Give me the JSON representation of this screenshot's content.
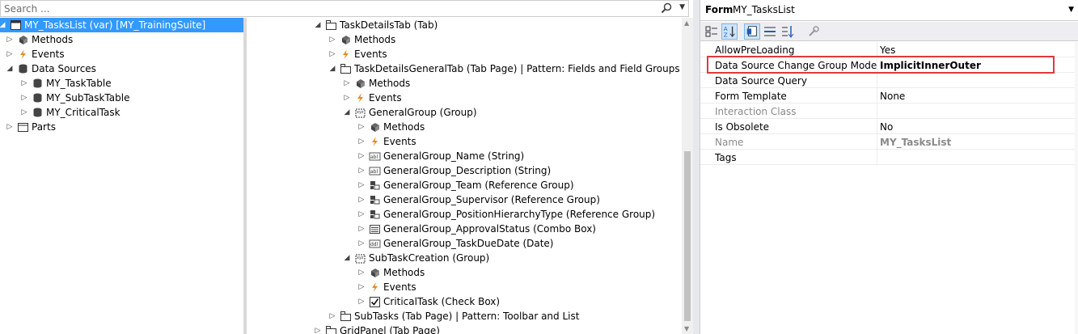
{
  "search": {
    "placeholder": "Search ..."
  },
  "tree_left": [
    {
      "label": "MY_TasksList (var) [MY_TrainingSuite]",
      "icon": "form-icon",
      "expander": "expanded",
      "selected": true
    },
    {
      "label": "Methods",
      "icon": "methods-icon",
      "expander": "collapsed"
    },
    {
      "label": "Events",
      "icon": "events-icon",
      "expander": "collapsed"
    },
    {
      "label": "Data Sources",
      "icon": "datasource-icon",
      "expander": "expanded"
    },
    {
      "label": "MY_TaskTable",
      "icon": "datasource-icon",
      "expander": "collapsed"
    },
    {
      "label": "MY_SubTaskTable",
      "icon": "datasource-icon",
      "expander": "collapsed"
    },
    {
      "label": "MY_CriticalTask",
      "icon": "datasource-icon",
      "expander": "collapsed"
    },
    {
      "label": "Parts",
      "icon": "parts-icon",
      "expander": "collapsed"
    }
  ],
  "tree_right": [
    {
      "label": "TaskDetailsTab (Tab)",
      "icon": "tab-icon",
      "expander": "expanded"
    },
    {
      "label": "Methods",
      "icon": "methods-icon",
      "expander": "collapsed"
    },
    {
      "label": "Events",
      "icon": "events-icon",
      "expander": "collapsed"
    },
    {
      "label": "TaskDetailsGeneralTab (Tab Page) | Pattern: Fields and Field Groups",
      "icon": "tab-icon",
      "expander": "expanded"
    },
    {
      "label": "Methods",
      "icon": "methods-icon",
      "expander": "collapsed"
    },
    {
      "label": "Events",
      "icon": "events-icon",
      "expander": "collapsed"
    },
    {
      "label": "GeneralGroup (Group)",
      "icon": "group-icon",
      "expander": "expanded"
    },
    {
      "label": "Methods",
      "icon": "methods-icon",
      "expander": "collapsed"
    },
    {
      "label": "Events",
      "icon": "events-icon",
      "expander": "collapsed"
    },
    {
      "label": "GeneralGroup_Name (String)",
      "icon": "string-icon",
      "expander": "collapsed"
    },
    {
      "label": "GeneralGroup_Description (String)",
      "icon": "string-icon",
      "expander": "collapsed"
    },
    {
      "label": "GeneralGroup_Team (Reference Group)",
      "icon": "refgroup-icon",
      "expander": "collapsed"
    },
    {
      "label": "GeneralGroup_Supervisor (Reference Group)",
      "icon": "refgroup-icon",
      "expander": "collapsed"
    },
    {
      "label": "GeneralGroup_PositionHierarchyType (Reference Group)",
      "icon": "refgroup-icon",
      "expander": "collapsed"
    },
    {
      "label": "GeneralGroup_ApprovalStatus (Combo Box)",
      "icon": "combobox-icon",
      "expander": "collapsed"
    },
    {
      "label": "GeneralGroup_TaskDueDate (Date)",
      "icon": "date-icon",
      "expander": "collapsed"
    },
    {
      "label": "SubTaskCreation (Group)",
      "icon": "group-icon",
      "expander": "expanded"
    },
    {
      "label": "Methods",
      "icon": "methods-icon",
      "expander": "collapsed"
    },
    {
      "label": "Events",
      "icon": "events-icon",
      "expander": "collapsed"
    },
    {
      "label": "CriticalTask (Check Box)",
      "icon": "checkbox-icon",
      "expander": "collapsed"
    },
    {
      "label": "SubTasks (Tab Page) | Pattern: Toolbar and List",
      "icon": "tab-icon",
      "expander": "collapsed"
    },
    {
      "label": "GridPanel (Tab Page)",
      "icon": "tab-icon",
      "expander": "collapsed"
    }
  ],
  "properties": {
    "object_type": "Form",
    "object_name": "MY_TasksList",
    "rows": [
      {
        "name": "AllowPreLoading",
        "value": "Yes",
        "disabled": false,
        "bold": false
      },
      {
        "name": "Data Source Change Group Mode",
        "value": "ImplicitInnerOuter",
        "disabled": false,
        "bold": true
      },
      {
        "name": "Data Source Query",
        "value": "",
        "disabled": false,
        "bold": false
      },
      {
        "name": "Form Template",
        "value": "None",
        "disabled": false,
        "bold": false
      },
      {
        "name": "Interaction Class",
        "value": "",
        "disabled": true,
        "bold": false
      },
      {
        "name": "Is Obsolete",
        "value": "No",
        "disabled": false,
        "bold": false
      },
      {
        "name": "Name",
        "value": "MY_TasksList",
        "disabled": true,
        "bold": true
      },
      {
        "name": "Tags",
        "value": "",
        "disabled": false,
        "bold": false
      }
    ]
  },
  "colors": {
    "selection": "#3399ff",
    "highlight_border": "#e03a3a"
  }
}
